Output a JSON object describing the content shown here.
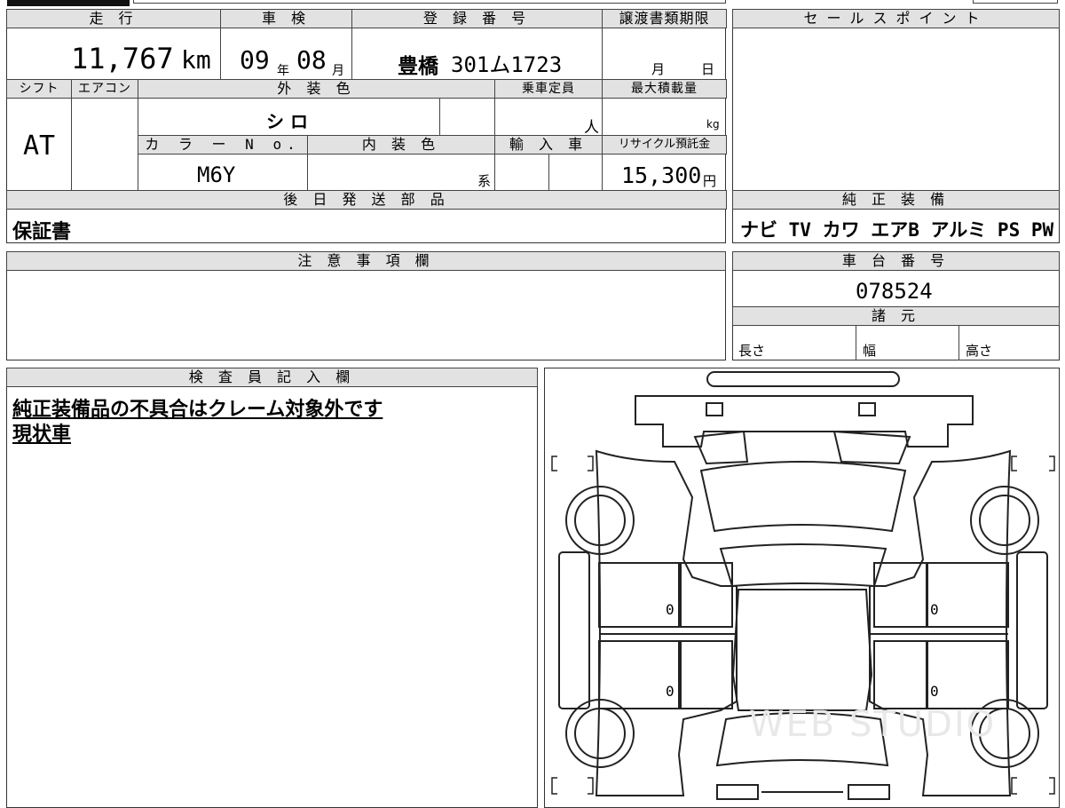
{
  "top_headers": {
    "mileage": "走 行",
    "inspection": "車 検",
    "registration": "登 録 番 号",
    "transfer_deadline": "譲渡書類期限",
    "sales_point": "セールスポイント"
  },
  "mileage": {
    "number": "11,767",
    "unit": "km"
  },
  "inspection": {
    "year": "09",
    "year_unit": "年",
    "month": "08",
    "month_unit": "月"
  },
  "registration": {
    "city": "豊橋",
    "number": "301ム1723"
  },
  "transfer_deadline": {
    "month_unit": "月",
    "day_unit": "日"
  },
  "row2_headers": {
    "shift": "シフト",
    "aircon": "エアコン",
    "exterior_color": "外 装 色",
    "capacity": "乗車定員",
    "max_load": "最大積載量",
    "color_no": "カ ラ ー N o.",
    "interior_color": "内 装 色",
    "import": "輸 入 車",
    "recycle": "リサイクル預託金"
  },
  "shift_value": "AT",
  "exterior_color_value": "シ ロ",
  "capacity_unit": "人",
  "load_unit": "kg",
  "color_no_value": "M6Y",
  "interior_color_unit": "系",
  "recycle": {
    "amount": "15,300",
    "unit": "円"
  },
  "later_parts": {
    "header": "後 日 発 送 部 品",
    "value": "保証書"
  },
  "oem_equipment": {
    "header": "純 正 装 備",
    "value": "ナビ TV カワ エアB アルミ PS PW"
  },
  "notes": {
    "header": "注 意 事 項 欄"
  },
  "chassis": {
    "header": "車 台 番 号",
    "value": "078524"
  },
  "specs": {
    "header": "諸 元",
    "length": "長さ",
    "width": "幅",
    "height": "高さ"
  },
  "inspector": {
    "header": "検 査 員 記 入 欄",
    "line1": "純正装備品の不具合はクレーム対象外です",
    "line2": "現状車"
  },
  "diagram": {
    "marks": [
      "0",
      "0",
      "0",
      "0"
    ],
    "watermark": "WEB STUDIO"
  }
}
